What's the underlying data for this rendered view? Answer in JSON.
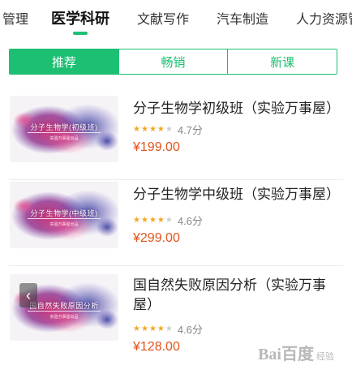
{
  "category_tabs": [
    {
      "label": "管理",
      "active": false
    },
    {
      "label": "医学科研",
      "active": true
    },
    {
      "label": "文献写作",
      "active": false
    },
    {
      "label": "汽车制造",
      "active": false
    },
    {
      "label": "人力资源管",
      "active": false
    }
  ],
  "segments": [
    {
      "label": "推荐",
      "active": true
    },
    {
      "label": "畅销",
      "active": false
    },
    {
      "label": "新课",
      "active": false
    }
  ],
  "courses": [
    {
      "title": "分子生物学初级班（实验万事屋）",
      "rating": "4.7分",
      "rating_value": 4.7,
      "price": "¥199.00",
      "thumb_title": "分子生物学(初级班)",
      "thumb_sub": "实验万事屋出品"
    },
    {
      "title": "分子生物学中级班（实验万事屋）",
      "rating": "4.6分",
      "rating_value": 4.6,
      "price": "¥299.00",
      "thumb_title": "分子生物学(中级班)",
      "thumb_sub": "实验万事屋出品"
    },
    {
      "title": "国自然失败原因分析（实验万事屋）",
      "rating": "4.6分",
      "rating_value": 4.6,
      "price": "¥128.00",
      "thumb_title": "国自然失败原因分析",
      "thumb_sub": "实验万事屋出品"
    }
  ],
  "back_icon": "chevron-left-icon",
  "watermark": {
    "logo": "Bai百度",
    "sub": "经验"
  },
  "colors": {
    "accent": "#1dbf73",
    "price": "#e2531c",
    "star": "#f5a623"
  }
}
